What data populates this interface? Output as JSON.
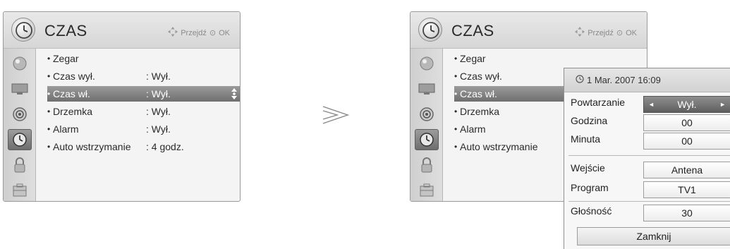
{
  "left_panel": {
    "title": "CZAS",
    "nav_hint": "Przejdź",
    "ok_hint": "OK",
    "items": [
      {
        "label": "Zegar",
        "value": ""
      },
      {
        "label": "Czas wył.",
        "value": ": Wył."
      },
      {
        "label": "Czas wł.",
        "value": ": Wył."
      },
      {
        "label": "Drzemka",
        "value": ": Wył."
      },
      {
        "label": "Alarm",
        "value": ": Wył."
      },
      {
        "label": "Auto wstrzymanie",
        "value": ": 4 godz."
      }
    ],
    "selected_index": 2
  },
  "right_panel": {
    "title": "CZAS",
    "nav_hint": "Przejdź",
    "ok_hint": "OK",
    "items": [
      {
        "label": "Zegar"
      },
      {
        "label": "Czas wył."
      },
      {
        "label": "Czas wł."
      },
      {
        "label": "Drzemka"
      },
      {
        "label": "Alarm"
      },
      {
        "label": "Auto wstrzymanie"
      }
    ],
    "selected_index": 2
  },
  "popup": {
    "datetime": "1 Mar. 2007 16:09",
    "rows": {
      "repeat": {
        "label": "Powtarzanie",
        "value": "Wył."
      },
      "hour": {
        "label": "Godzina",
        "value": "00"
      },
      "minute": {
        "label": "Minuta",
        "value": "00"
      },
      "input": {
        "label": "Wejście",
        "value": "Antena"
      },
      "program": {
        "label": "Program",
        "value": "TV1"
      },
      "volume": {
        "label": "Głośność",
        "value": "30"
      }
    },
    "close_label": "Zamknij"
  },
  "sidebar_icons": [
    {
      "name": "picture-icon"
    },
    {
      "name": "screen-icon"
    },
    {
      "name": "audio-icon"
    },
    {
      "name": "time-icon",
      "active": true
    },
    {
      "name": "lock-icon"
    },
    {
      "name": "option-icon"
    }
  ],
  "colors": {
    "selected_bar": "#7c7c7c",
    "panel_bg": "#f4f4f4",
    "header_bg": "#dcdcdc"
  }
}
